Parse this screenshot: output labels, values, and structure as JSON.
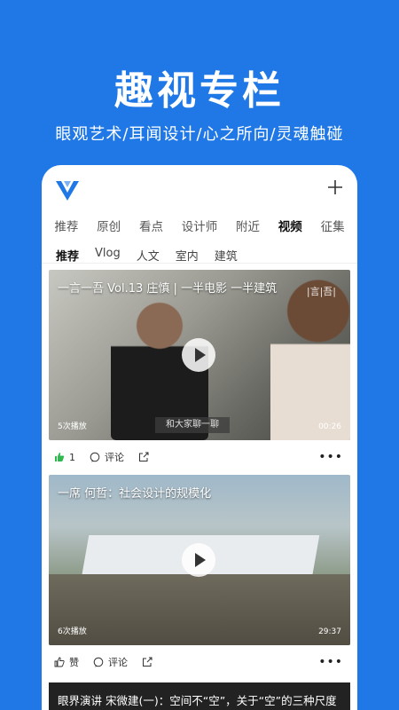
{
  "hero": {
    "title": "趣视专栏",
    "subtitle": "眼观艺术/耳闻设计/心之所向/灵魂触碰"
  },
  "app": {
    "tabs": [
      "推荐",
      "原创",
      "看点",
      "设计师",
      "附近",
      "视频",
      "征集"
    ],
    "active_tab": "视频",
    "subtabs": [
      "推荐",
      "Vlog",
      "人文",
      "室内",
      "建筑"
    ],
    "active_subtab": "推荐"
  },
  "cards": [
    {
      "title": "一言一吾 Vol.13 庄慎 | 一半电影 一半建筑",
      "plays": "5次播放",
      "duration": "00:26",
      "caption": "和大家聊一聊",
      "watermark": "|言|吾|",
      "like_count": "1",
      "comment_label": "评论"
    },
    {
      "title": "一席 何哲：社会设计的规模化",
      "plays": "6次播放",
      "duration": "29:37",
      "like_label": "赞",
      "comment_label": "评论"
    },
    {
      "title": "眼界演讲 宋微建(一)：空间不“空”，关于“空”的三种尺度"
    }
  ],
  "icons": {
    "logo": "v-logo-icon",
    "plus": "plus-icon",
    "like": "thumbs-up-icon",
    "comment": "comment-icon",
    "share": "share-icon",
    "more": "more-dots-icon",
    "play": "play-icon"
  },
  "colors": {
    "background": "#1f78e6",
    "like_active": "#2eb84e"
  }
}
